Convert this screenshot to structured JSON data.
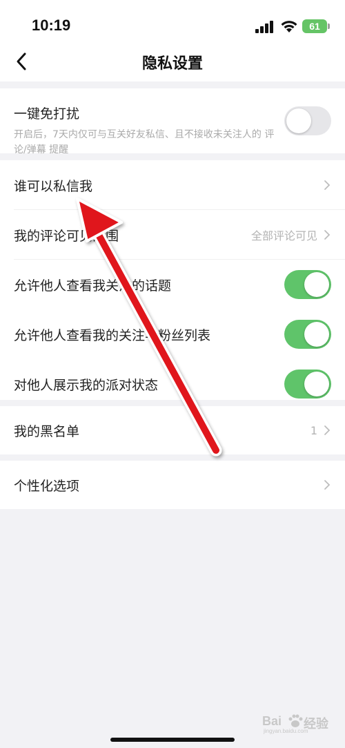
{
  "status_bar": {
    "time": "10:19",
    "battery": "61",
    "icons": [
      "signal-icon",
      "wifi-icon",
      "battery-icon"
    ]
  },
  "nav": {
    "title": "隐私设置",
    "back_icon": "chevron-left-icon"
  },
  "do_not_disturb": {
    "title": "一键免打扰",
    "description": "开启后，7天内仅可与互关好友私信、且不接收未关注人的 评论/弹幕 提醒",
    "enabled": false
  },
  "privacy_items": [
    {
      "label": "谁可以私信我",
      "value": ""
    },
    {
      "label": "我的评论可见范围",
      "value": "全部评论可见"
    }
  ],
  "toggle_items": [
    {
      "label": "允许他人查看我关注的话题",
      "enabled": true
    },
    {
      "label": "允许他人查看我的关注与粉丝列表",
      "enabled": true
    },
    {
      "label": "对他人展示我的派对状态",
      "enabled": true
    }
  ],
  "blacklist": {
    "label": "我的黑名单",
    "value": "1"
  },
  "personalization": {
    "label": "个性化选项"
  },
  "watermark": {
    "brand_left": "Bai",
    "brand_right": "经验",
    "sub": "jingyan.baidu.com"
  },
  "colors": {
    "toggle_on": "#5fc46a",
    "toggle_off": "#e6e6e9",
    "arrow": "#e0141e",
    "background": "#f2f2f5"
  }
}
